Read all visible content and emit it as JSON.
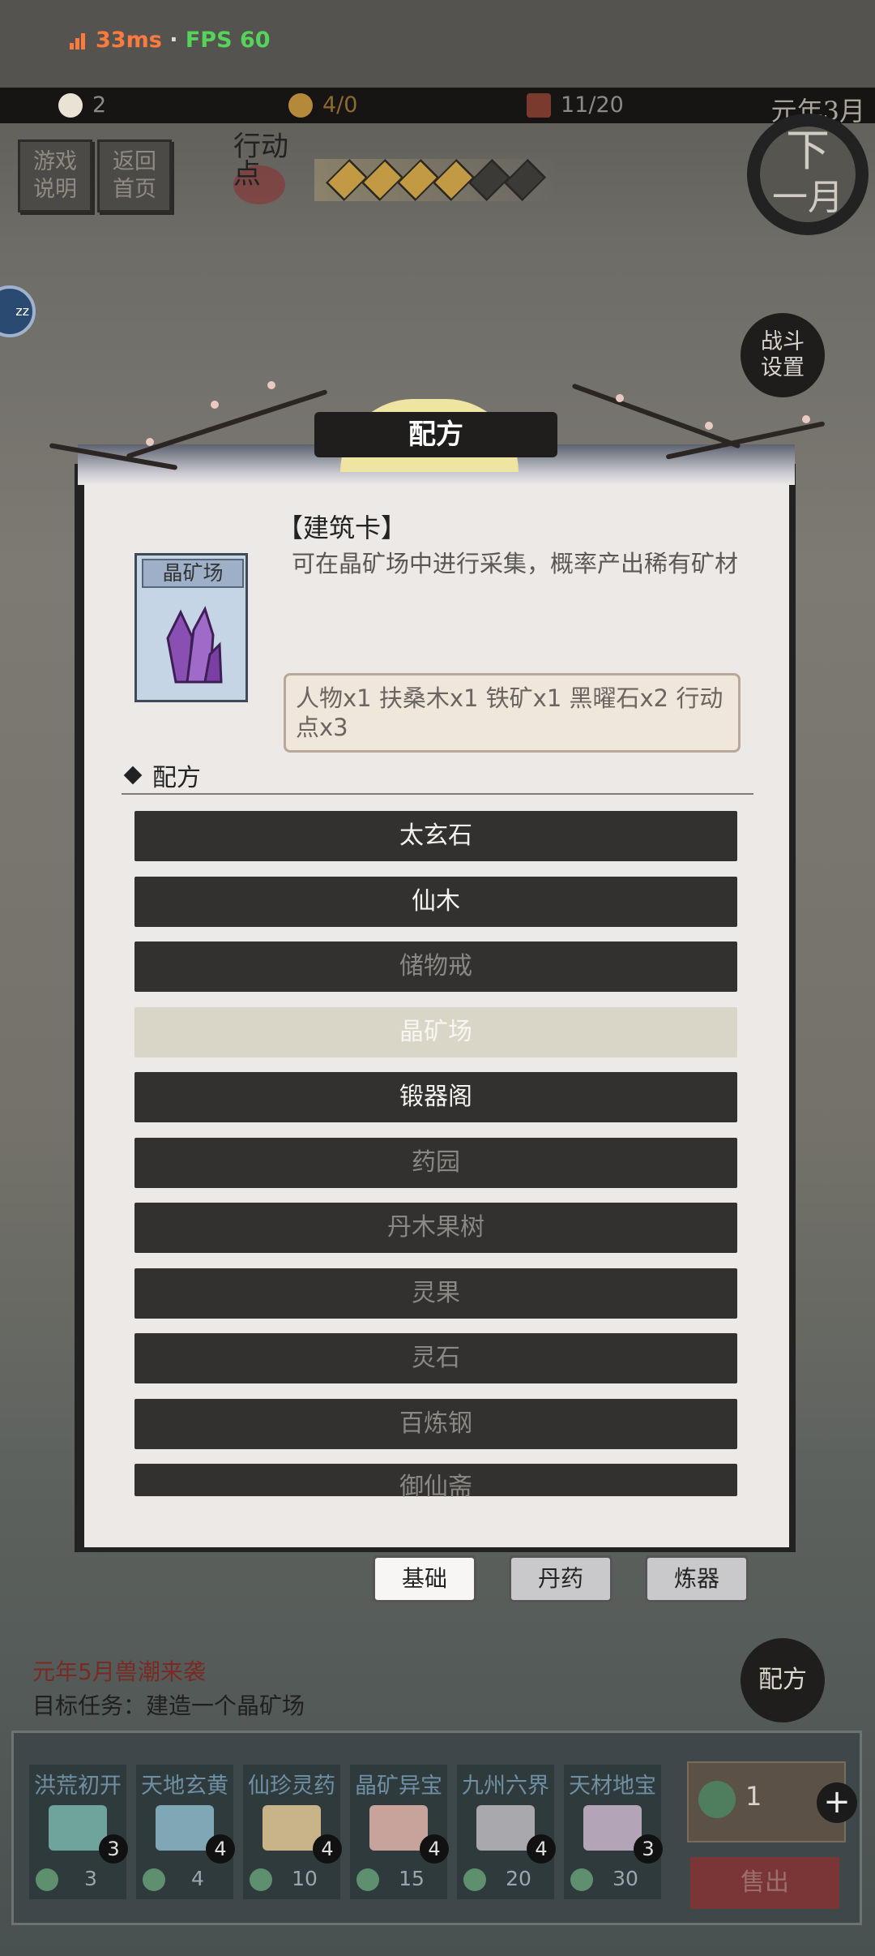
{
  "status": {
    "ping": "33ms",
    "separator": "·",
    "fps": "FPS 60"
  },
  "resources": {
    "people": "2",
    "food": "4/0",
    "cards": "11/20",
    "date": "元年3月"
  },
  "top_buttons": {
    "help": "游戏说明",
    "home": "返回首页"
  },
  "action_points": {
    "label": "行动点",
    "filled": 4,
    "total": 6
  },
  "next_month": {
    "label_top": "下",
    "label_bottom": "一月"
  },
  "zz_badge": "zz",
  "battle_settings": "战斗设置",
  "dialog": {
    "title": "配方",
    "card_name": "晶矿场",
    "card_type": "【建筑卡】",
    "description": "可在晶矿场中进行采集，概率产出稀有矿材",
    "cost": "人物x1 扶桑木x1 铁矿x1 黑曜石x2 行动点x3",
    "section_title": "配方",
    "recipes": [
      {
        "label": "太玄石",
        "state": "bright"
      },
      {
        "label": "仙木",
        "state": "bright"
      },
      {
        "label": "储物戒",
        "state": "dim"
      },
      {
        "label": "晶矿场",
        "state": "selected"
      },
      {
        "label": "锻器阁",
        "state": "bright"
      },
      {
        "label": "药园",
        "state": "dim"
      },
      {
        "label": "丹木果树",
        "state": "dim"
      },
      {
        "label": "灵果",
        "state": "dim"
      },
      {
        "label": "灵石",
        "state": "dim"
      },
      {
        "label": "百炼钢",
        "state": "dim"
      },
      {
        "label": "御仙斋",
        "state": "dim"
      }
    ],
    "tabs": [
      {
        "label": "基础",
        "active": true
      },
      {
        "label": "丹药",
        "active": false
      },
      {
        "label": "炼器",
        "active": false
      }
    ]
  },
  "event_text": "元年5月兽潮来袭",
  "quest_text": "目标任务：建造一个晶矿场",
  "recipe_button": "配方",
  "shop": {
    "packs": [
      {
        "name": "洪荒初开",
        "count": "3",
        "price": "3",
        "color": "#6fa49c"
      },
      {
        "name": "天地玄黄",
        "count": "4",
        "price": "4",
        "color": "#7fa7b5"
      },
      {
        "name": "仙珍灵药",
        "count": "4",
        "price": "10",
        "color": "#c9b48a"
      },
      {
        "name": "晶矿异宝",
        "count": "4",
        "price": "15",
        "color": "#c7a39c"
      },
      {
        "name": "九州六界",
        "count": "4",
        "price": "20",
        "color": "#a9a9ad"
      },
      {
        "name": "天材地宝",
        "count": "3",
        "price": "30",
        "color": "#b3a4b8"
      }
    ],
    "jade_amount": "1",
    "plus": "+",
    "sell": "售出"
  },
  "colors": {
    "accent_red": "#8a2b2b",
    "ping": "#ff7a3d",
    "fps": "#55d35b",
    "dialog_bg": "#ece9e6"
  }
}
